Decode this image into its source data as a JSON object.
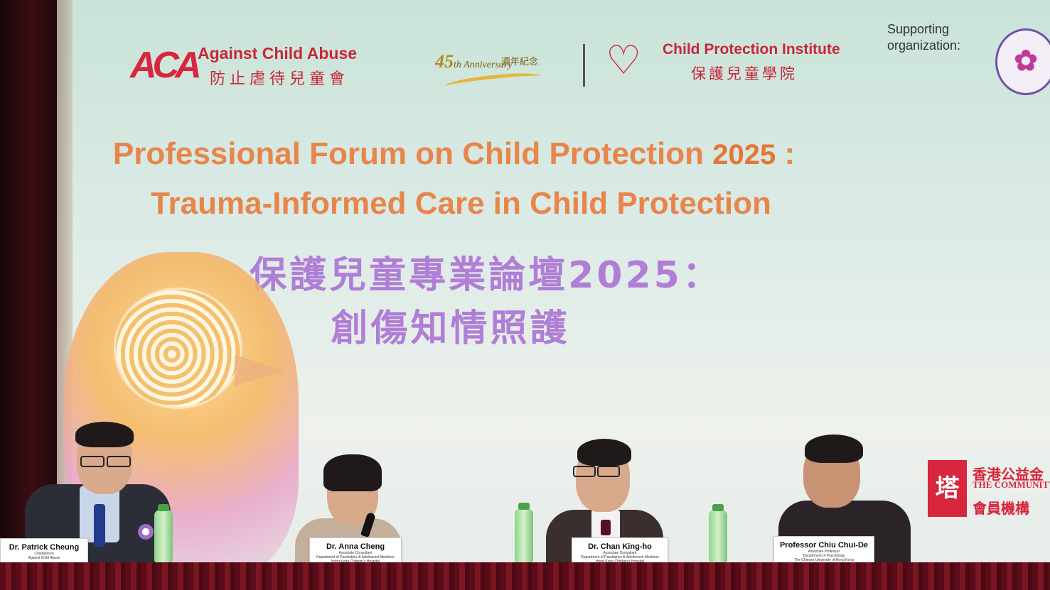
{
  "backdrop": {
    "organizer": {
      "logo_mark": "ACA",
      "name_en": "Against Child Abuse",
      "name_zh": "防止虐待兒童會"
    },
    "anniversary": {
      "number": "45",
      "suffix": "th Anniversary",
      "label_zh": "週年紀念"
    },
    "co_organizer": {
      "name_en": "Child Protection Institute",
      "name_zh": "保護兒童學院"
    },
    "supporting": {
      "label": "Supporting organization:"
    },
    "title_en_line1": "Professional Forum on Child Protection",
    "title_en_year": "2025",
    "title_en_colon": ":",
    "title_en_line2": "Trauma-Informed Care in Child Protection",
    "title_zh_line1": "保護兒童專業論壇2025：",
    "title_zh_line2": "創傷知情照護",
    "sponsor": {
      "name_zh": "香港公益金",
      "name_en": "THE COMMUNITY CHEST",
      "member_zh": "會員機構"
    }
  },
  "panelists": [
    {
      "name": "Dr. Patrick Cheung",
      "role": "Chairperson",
      "org": "Against Child Abuse"
    },
    {
      "name": "Dr. Anna Cheng",
      "role": "Associate Consultant",
      "org": "Department of Paediatrics & Adolescent Medicine",
      "org2": "Hong Kong Children's Hospital"
    },
    {
      "name": "Dr. Chan King-ho",
      "role": "Associate Consultant",
      "org": "Department of Paediatrics & Adolescent Medicine",
      "org2": "Hong Kong Children's Hospital"
    },
    {
      "name": "Professor Chiu Chui-De",
      "role": "Associate Professor",
      "org": "Department of Psychology",
      "org2": "The Chinese University of Hong Kong"
    }
  ],
  "colors": {
    "brand_red": "#c8263a",
    "title_orange": "#e8854a",
    "title_purple": "#b07ed6",
    "tablecloth": "#6a1020"
  }
}
